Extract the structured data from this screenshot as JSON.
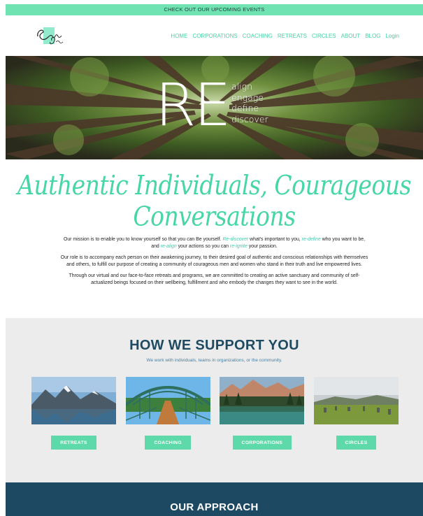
{
  "topbar": {
    "text": "CHECK OUT OUR UPCOMING EVENTS"
  },
  "header": {
    "logo_alt": "Embodied Beings",
    "nav": [
      "HOME",
      "CORPORATIONS",
      "COACHING",
      "RETREATS",
      "CIRCLES",
      "ABOUT",
      "BLOG",
      "Login"
    ]
  },
  "hero": {
    "big": "RE",
    "words": [
      "align",
      "engage",
      "define",
      "discover"
    ]
  },
  "script_title": "Authentic Individuals, Courageous Conversations",
  "mission": {
    "p1_a": "Our mission is to enable you to know yourself so that you can Be yourself. ",
    "p1_e1": "Re-discover",
    "p1_b": " what's important to you, ",
    "p1_e2": "re-define",
    "p1_c": " who you want to be, and ",
    "p1_e3": "re-align",
    "p1_d": " your actions so you can ",
    "p1_e4": "re-ignite",
    "p1_f": " your passion.",
    "p2": "Our role is to accompany each person on their awakening journey, to their desired goal of authentic and conscious relationships with themselves and others, to fulfill our purpose of creating a community of courageous men and women who stand in their truth and live empowered lives.",
    "p3": "Through our virtual and our face-to-face retreats and programs, we are committed to creating an active sanctuary and community of self-actualized beings focused on their wellbeing, fulfillment and who embody the changes they want to see in the world."
  },
  "support": {
    "title": "HOW WE SUPPORT YOU",
    "subtitle": "We work with individuals, teams in organizations, or the community.",
    "cards": [
      {
        "label": "RETREATS"
      },
      {
        "label": "COACHING"
      },
      {
        "label": "CORPORATIONS"
      },
      {
        "label": "CIRCLES"
      }
    ]
  },
  "approach": {
    "title": "OUR APPROACH"
  },
  "colors": {
    "accent": "#45d3a4",
    "topbar": "#6fe3b1",
    "navy": "#1d4a62",
    "button": "#5ed9a9"
  }
}
